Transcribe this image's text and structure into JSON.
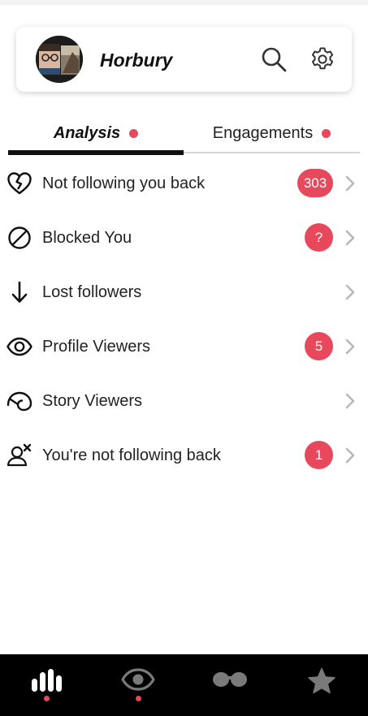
{
  "header": {
    "account_name": "Horbury",
    "search_icon": "search-icon",
    "settings_icon": "gear-icon"
  },
  "tabs": [
    {
      "label": "Analysis",
      "active": true,
      "has_dot": true
    },
    {
      "label": "Engagements",
      "active": false,
      "has_dot": true
    }
  ],
  "rows": [
    {
      "label": "Not following you back",
      "icon": "broken-heart-icon",
      "badge": "303"
    },
    {
      "label": "Blocked You",
      "icon": "blocked-icon",
      "badge": "?"
    },
    {
      "label": "Lost followers",
      "icon": "arrow-down-icon",
      "badge": ""
    },
    {
      "label": "Profile Viewers",
      "icon": "eye-icon",
      "badge": "5"
    },
    {
      "label": "Story Viewers",
      "icon": "story-icon",
      "badge": ""
    },
    {
      "label": "You're not following back",
      "icon": "user-remove-icon",
      "badge": "1"
    }
  ],
  "bottom_nav": [
    {
      "icon": "bar-chart-icon",
      "active": true,
      "has_dot": true
    },
    {
      "icon": "eye-icon",
      "active": false,
      "has_dot": true
    },
    {
      "icon": "glasses-icon",
      "active": false,
      "has_dot": false
    },
    {
      "icon": "star-icon",
      "active": false,
      "has_dot": false
    }
  ],
  "colors": {
    "accent": "#e8485c",
    "nav_background": "#000000",
    "nav_active": "#ffffff",
    "nav_inactive": "#777777"
  }
}
